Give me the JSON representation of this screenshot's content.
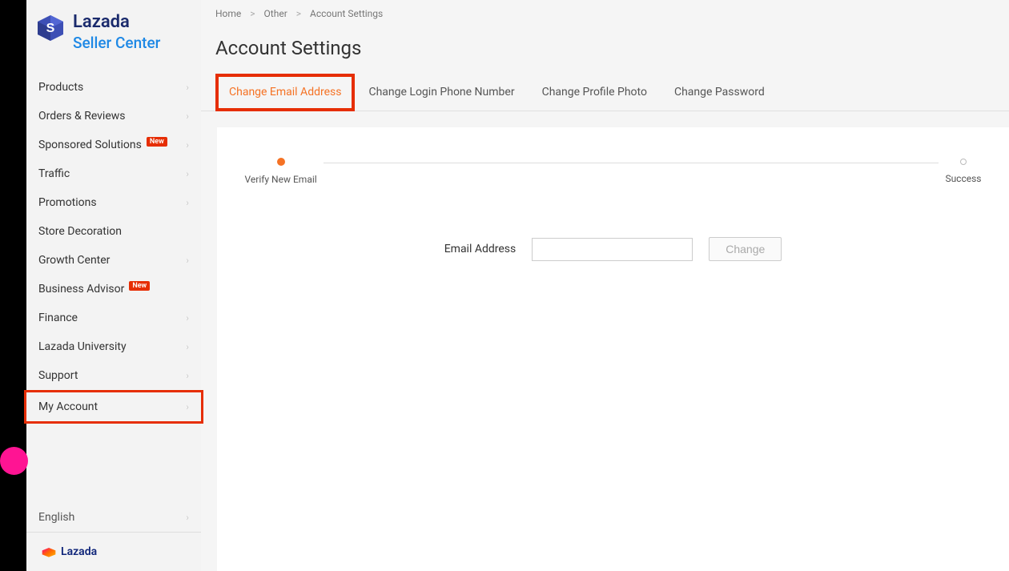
{
  "logo": {
    "brand": "Lazada",
    "sub": "Seller Center"
  },
  "nav": {
    "items": [
      {
        "label": "Products",
        "chevron": true,
        "badge": false
      },
      {
        "label": "Orders & Reviews",
        "chevron": true,
        "badge": false
      },
      {
        "label": "Sponsored Solutions",
        "chevron": true,
        "badge": true
      },
      {
        "label": "Traffic",
        "chevron": true,
        "badge": false
      },
      {
        "label": "Promotions",
        "chevron": true,
        "badge": false
      },
      {
        "label": "Store Decoration",
        "chevron": false,
        "badge": false
      },
      {
        "label": "Growth Center",
        "chevron": true,
        "badge": false
      },
      {
        "label": "Business Advisor",
        "chevron": false,
        "badge": true
      },
      {
        "label": "Finance",
        "chevron": true,
        "badge": false
      },
      {
        "label": "Lazada University",
        "chevron": true,
        "badge": false
      },
      {
        "label": "Support",
        "chevron": true,
        "badge": false
      },
      {
        "label": "My Account",
        "chevron": true,
        "badge": false,
        "highlighted": true
      }
    ],
    "badge_text": "New",
    "language": "English"
  },
  "footer_logo": "Lazada",
  "breadcrumb": {
    "home": "Home",
    "other": "Other",
    "current": "Account Settings"
  },
  "page_title": "Account Settings",
  "tabs": [
    {
      "label": "Change Email Address",
      "active": true
    },
    {
      "label": "Change Login Phone Number",
      "active": false
    },
    {
      "label": "Change Profile Photo",
      "active": false
    },
    {
      "label": "Change Password",
      "active": false
    }
  ],
  "steps": [
    {
      "label": "Verify New Email",
      "active": true
    },
    {
      "label": "Success",
      "active": false
    }
  ],
  "form": {
    "label": "Email Address",
    "button": "Change"
  }
}
